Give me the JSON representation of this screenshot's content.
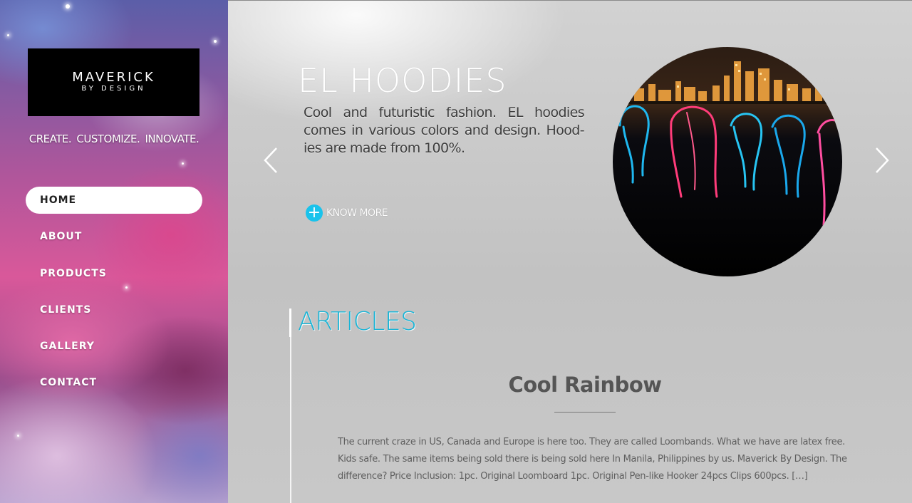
{
  "brand": {
    "logo_main": "MAVERICK",
    "logo_sub": "BY DESIGN",
    "tagline": "CREATE. CUSTOMIZE. INNOVATE."
  },
  "nav": {
    "items": [
      {
        "label": "HOME",
        "active": true
      },
      {
        "label": "ABOUT",
        "active": false
      },
      {
        "label": "PRODUCTS",
        "active": false
      },
      {
        "label": "CLIENTS",
        "active": false
      },
      {
        "label": "GALLERY",
        "active": false
      },
      {
        "label": "CONTACT",
        "active": false
      }
    ]
  },
  "hero": {
    "title": "EL HOODIES",
    "description": "Cool and futuristic fashion. EL hoodies comes in various colors and design. Hood-ies are made from 100%.",
    "cta_label": "KNOW MORE",
    "cta_icon": "plus-icon",
    "prev_icon": "chevron-left-icon",
    "next_icon": "chevron-right-icon"
  },
  "articles": {
    "heading": "ARTICLES",
    "items": [
      {
        "title": "Cool Rainbow",
        "body": "The current craze in US, Canada and Europe is here too. They are called Loombands. What we have are latex free. Kids safe. The same items being sold there is being sold here In Manila, Philippines by us. Maverick By Design. The difference? Price Inclusion: 1pc. Original Loomboard 1pc. Original Pen-like Hooker 24pcs Clips 600pcs. […]"
      }
    ]
  },
  "colors": {
    "accent": "#18b4d6",
    "cta_icon_bg": "#19c3ec",
    "sidebar_active_bg": "#ffffff"
  }
}
